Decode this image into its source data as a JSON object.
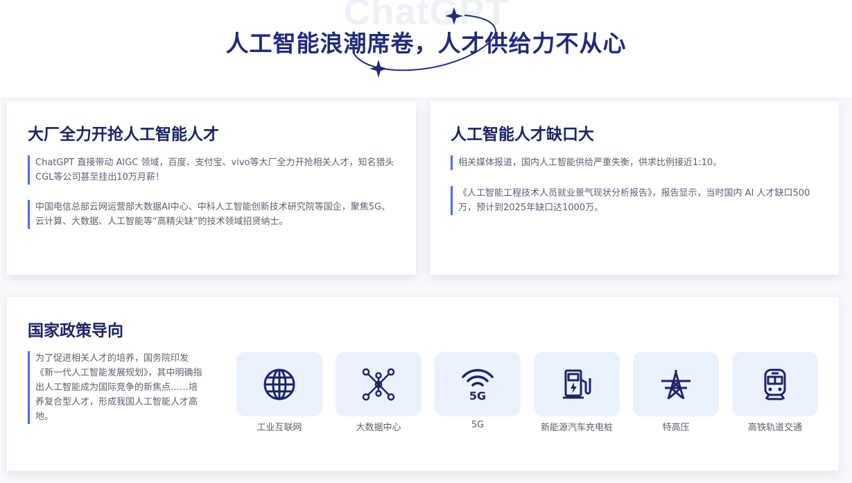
{
  "header": {
    "watermark": "ChatGPT",
    "title": "人工智能浪潮席卷，人才供给力不从心"
  },
  "card_left": {
    "title": "大厂全力开抢人工智能人才",
    "paragraphs": [
      "ChatGPT 直接带动 AIGC 领域，百度、支付宝、vivo等大厂全力开抢相关人才，知名猎头CGL等公司甚至挂出10万月薪！",
      "中国电信总部云网运营部大数据AI中心、中科人工智能创新技术研究院等国企，聚焦5G、云计算、大数据、人工智能等“高精尖缺”的技术领域招贤纳士。"
    ]
  },
  "card_right": {
    "title": "人工智能人才缺口大",
    "paragraphs": [
      "相关媒体报道，国内人工智能供给严重失衡，供求比例接近1:10。",
      "《人工智能工程技术人员就业景气现状分析报告》，报告显示，当时国内 AI 人才缺口500万，预计到2025年缺口达1000万。"
    ]
  },
  "policy": {
    "title": "国家政策导向",
    "paragraph": "为了促进相关人才的培养，国务院印发《新一代人工智能发展规划》，其中明确指出人工智能成为国际竞争的新焦点……培养复合型人才，形成我国人工智能人才高地。",
    "tiles": [
      {
        "label": "工业互联网",
        "icon": "globe-icon"
      },
      {
        "label": "大数据中心",
        "icon": "network-nodes-icon"
      },
      {
        "label": "5G",
        "icon": "5g-signal-icon",
        "icon_text": "5G"
      },
      {
        "label": "新能源汽车充电桩",
        "icon": "charging-pile-icon"
      },
      {
        "label": "特高压",
        "icon": "power-tower-icon"
      },
      {
        "label": "高铁轨道交通",
        "icon": "train-icon"
      }
    ]
  },
  "colors": {
    "title": "#1f2b7a",
    "accent_bar": "#4a6cf0",
    "tile_bg": "#eaf2fe",
    "icon": "#1b2465"
  }
}
